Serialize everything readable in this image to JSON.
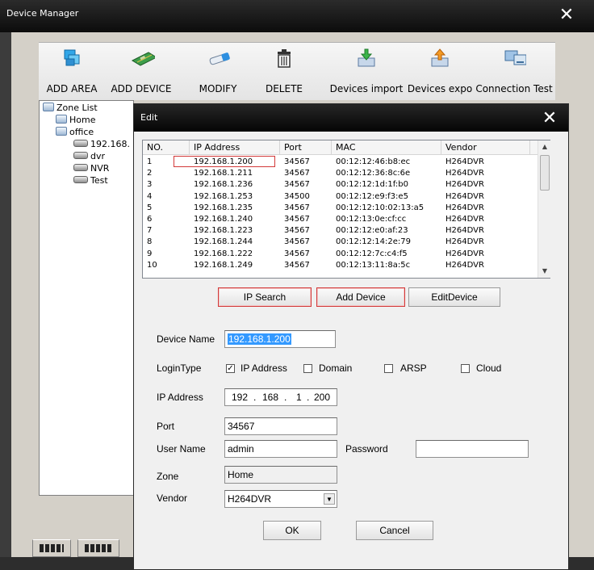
{
  "window": {
    "title": "Device Manager",
    "close_glyph": "✕"
  },
  "toolbar": {
    "buttons": [
      {
        "label": "ADD AREA",
        "icon": "add-area-icon"
      },
      {
        "label": "ADD DEVICE",
        "icon": "add-device-icon"
      },
      {
        "label": "MODIFY",
        "icon": "modify-icon"
      },
      {
        "label": "DELETE",
        "icon": "delete-icon"
      },
      {
        "label": "Devices import",
        "icon": "import-icon"
      },
      {
        "label": "Devices expo",
        "icon": "export-icon"
      },
      {
        "label": "Connection Test",
        "icon": "connection-test-icon"
      }
    ]
  },
  "tree": {
    "root": "Zone List",
    "nodes": [
      "Home",
      "office",
      "192.168.",
      "dvr",
      "NVR",
      "Test"
    ]
  },
  "edit": {
    "title": "Edit",
    "close_glyph": "✕",
    "columns": [
      "NO.",
      "IP Address",
      "Port",
      "MAC",
      "Vendor"
    ],
    "rows": [
      {
        "no": "1",
        "ip": "192.168.1.200",
        "port": "34567",
        "mac": "00:12:12:46:b8:ec",
        "vendor": "H264DVR"
      },
      {
        "no": "2",
        "ip": "192.168.1.211",
        "port": "34567",
        "mac": "00:12:12:36:8c:6e",
        "vendor": "H264DVR"
      },
      {
        "no": "3",
        "ip": "192.168.1.236",
        "port": "34567",
        "mac": "00:12:12:1d:1f:b0",
        "vendor": "H264DVR"
      },
      {
        "no": "4",
        "ip": "192.168.1.253",
        "port": "34500",
        "mac": "00:12:12:e9:f3:e5",
        "vendor": "H264DVR"
      },
      {
        "no": "5",
        "ip": "192.168.1.235",
        "port": "34567",
        "mac": "00:12:12:10:02:13:a5",
        "vendor": "H264DVR"
      },
      {
        "no": "6",
        "ip": "192.168.1.240",
        "port": "34567",
        "mac": "00:12:13:0e:cf:cc",
        "vendor": "H264DVR"
      },
      {
        "no": "7",
        "ip": "192.168.1.223",
        "port": "34567",
        "mac": "00:12:12:e0:af:23",
        "vendor": "H264DVR"
      },
      {
        "no": "8",
        "ip": "192.168.1.244",
        "port": "34567",
        "mac": "00:12:12:14:2e:79",
        "vendor": "H264DVR"
      },
      {
        "no": "9",
        "ip": "192.168.1.222",
        "port": "34567",
        "mac": "00:12:12:7c:c4:f5",
        "vendor": "H264DVR"
      },
      {
        "no": "10",
        "ip": "192.168.1.249",
        "port": "34567",
        "mac": "00:12:13:11:8a:5c",
        "vendor": "H264DVR"
      }
    ],
    "buttons": {
      "ip_search": "IP Search",
      "add_device": "Add Device",
      "edit_device": "EditDevice",
      "ok": "OK",
      "cancel": "Cancel"
    },
    "form": {
      "device_name_label": "Device Name",
      "device_name_value": "192.168.1.200",
      "login_type_label": "LoginType",
      "login_types": [
        {
          "label": "IP Address",
          "checked": true
        },
        {
          "label": "Domain",
          "checked": false
        },
        {
          "label": "ARSP",
          "checked": false
        },
        {
          "label": "Cloud",
          "checked": false
        }
      ],
      "ip_address_label": "IP Address",
      "ip_octets": [
        "192",
        "168",
        "1",
        "200"
      ],
      "ip_separator": ".",
      "port_label": "Port",
      "port_value": "34567",
      "user_name_label": "User Name",
      "user_name_value": "admin",
      "password_label": "Password",
      "password_value": "",
      "zone_label": "Zone",
      "zone_value": "Home",
      "vendor_label": "Vendor",
      "vendor_value": "H264DVR"
    }
  },
  "colors": {
    "highlight_border": "#d23a3a",
    "selection_bg": "#3399ff",
    "titlebar": "#0c0c0c"
  }
}
